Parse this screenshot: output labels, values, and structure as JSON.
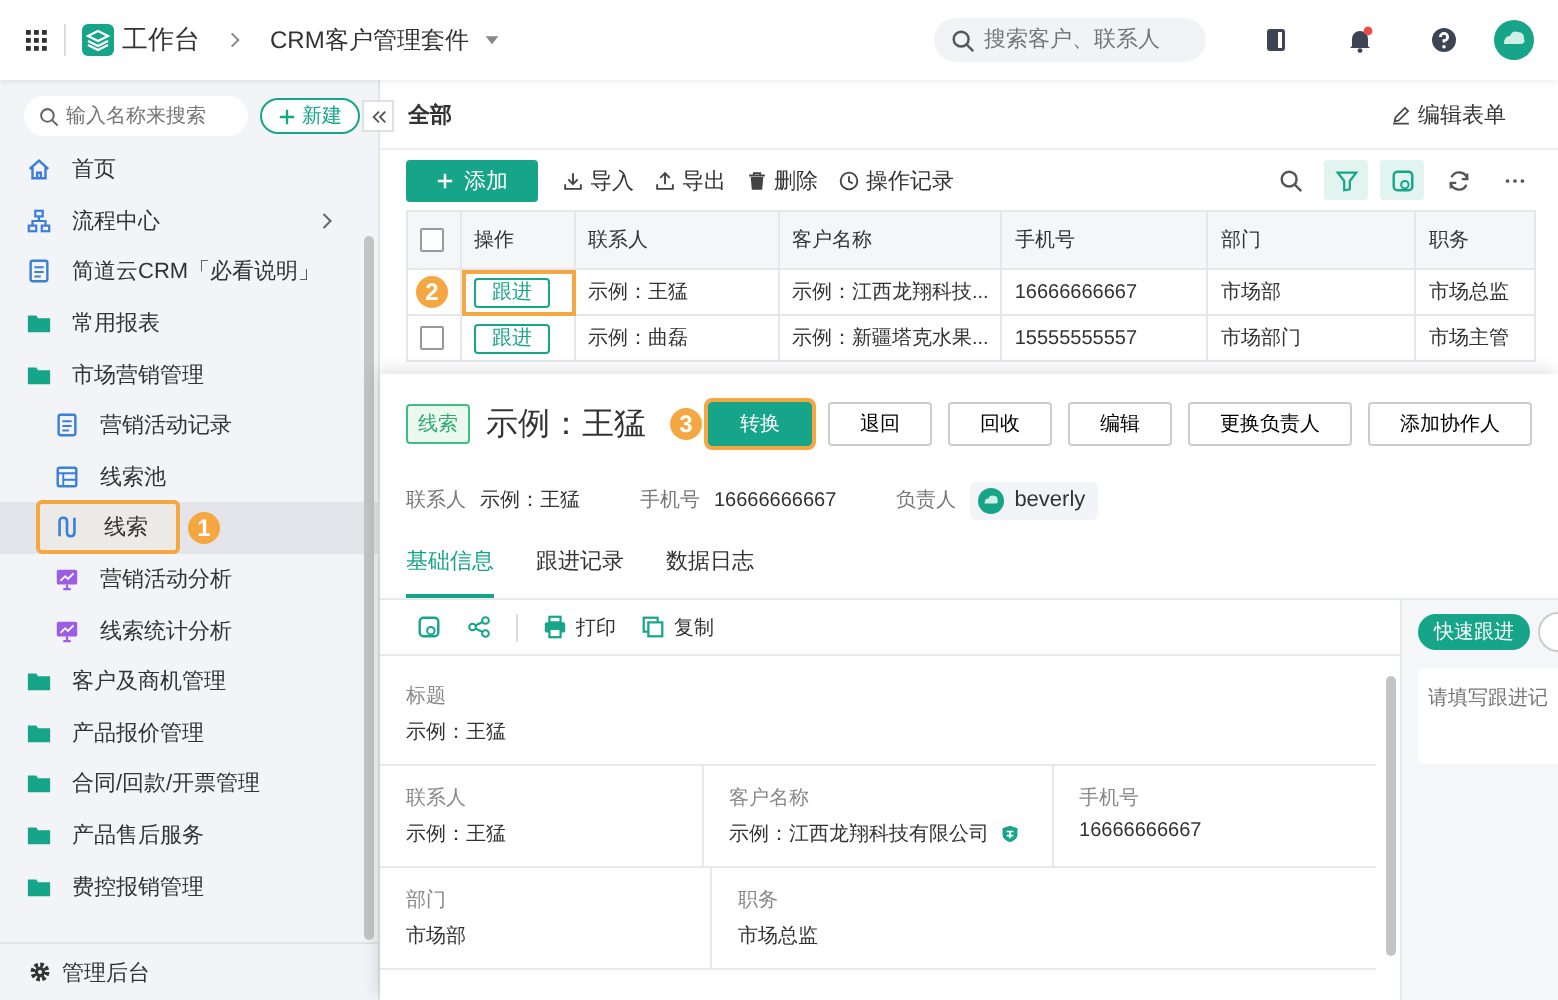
{
  "top_bar": {
    "app_name": "工作台",
    "breadcrumb": "CRM客户管理套件",
    "search": {
      "placeholder": "搜索客户、联系人"
    },
    "notifications_unread": true
  },
  "sidebar": {
    "search": {
      "placeholder": "输入名称来搜索"
    },
    "new_button": "新建",
    "items": [
      {
        "label": "首页",
        "kind": "home",
        "selected": false
      },
      {
        "label": "流程中心",
        "kind": "flow",
        "selected": false
      },
      {
        "label": "简道云CRM「必看说明」",
        "kind": "doc",
        "selected": false
      },
      {
        "label": "常用报表",
        "kind": "folder",
        "selected": false
      },
      {
        "label": "市场营销管理",
        "kind": "folder",
        "selected": false,
        "children": [
          {
            "label": "营销活动记录",
            "kind": "doc",
            "selected": false
          },
          {
            "label": "线索池",
            "kind": "pool",
            "selected": false
          },
          {
            "label": "线索",
            "kind": "lead",
            "selected": true,
            "callout": "1"
          },
          {
            "label": "营销活动分析",
            "kind": "chart",
            "selected": false
          },
          {
            "label": "线索统计分析",
            "kind": "chart",
            "selected": false
          }
        ]
      },
      {
        "label": "客户及商机管理",
        "kind": "folder",
        "selected": false
      },
      {
        "label": "产品报价管理",
        "kind": "folder",
        "selected": false
      },
      {
        "label": "合同/回款/开票管理",
        "kind": "folder",
        "selected": false
      },
      {
        "label": "产品售后服务",
        "kind": "folder",
        "selected": false
      },
      {
        "label": "费控报销管理",
        "kind": "folder",
        "selected": false
      }
    ],
    "footer": "管理后台"
  },
  "main": {
    "view_title": "全部",
    "edit_form": "编辑表单",
    "add_button": "添加",
    "actions": [
      {
        "label": "导入",
        "kind": "import"
      },
      {
        "label": "导出",
        "kind": "export"
      },
      {
        "label": "删除",
        "kind": "delete"
      },
      {
        "label": "操作记录",
        "kind": "history"
      }
    ],
    "tools": [
      {
        "kind": "search",
        "active": false
      },
      {
        "kind": "filter",
        "active": true
      },
      {
        "kind": "card",
        "active": true
      },
      {
        "kind": "refresh",
        "active": false
      },
      {
        "kind": "more",
        "active": false
      }
    ],
    "table": {
      "all_checked": false,
      "action_column": "操作",
      "columns": [
        "联系人",
        "客户名称",
        "手机号",
        "部门",
        "职务"
      ],
      "rows": [
        {
          "callout": "2",
          "action": "跟进",
          "cells": [
            "示例：王猛",
            "示例：江西龙翔科技...",
            "16666666667",
            "市场部",
            "市场总监"
          ]
        },
        {
          "checked": false,
          "action": "跟进",
          "cells": [
            "示例：曲磊",
            "示例：新疆塔克水果...",
            "15555555557",
            "市场部门",
            "市场主管"
          ]
        }
      ]
    }
  },
  "detail": {
    "tag": "线索",
    "title": "示例：王猛",
    "buttons": [
      {
        "label": "转换",
        "primary": true,
        "callout": "3"
      },
      {
        "label": "退回",
        "primary": false
      },
      {
        "label": "回收",
        "primary": false
      },
      {
        "label": "编辑",
        "primary": false
      },
      {
        "label": "更换负责人",
        "primary": false
      },
      {
        "label": "添加协作人",
        "primary": false
      }
    ],
    "info": [
      {
        "label": "联系人",
        "value": "示例：王猛"
      },
      {
        "label": "手机号",
        "value": "16666666667"
      }
    ],
    "owner": {
      "label": "负责人",
      "name": "beverly"
    },
    "tabs": [
      {
        "label": "基础信息",
        "selected": true
      },
      {
        "label": "跟进记录",
        "selected": false
      },
      {
        "label": "数据日志",
        "selected": false
      }
    ],
    "tools": [
      {
        "kind": "card"
      },
      {
        "kind": "share"
      },
      {
        "kind": "print",
        "label": "打印"
      },
      {
        "kind": "copy",
        "label": "复制"
      }
    ],
    "field_rows": [
      [
        {
          "label": "标题",
          "value": "示例：王猛",
          "verified": false
        }
      ],
      [
        {
          "label": "联系人",
          "value": "示例：王猛",
          "verified": false
        },
        {
          "label": "客户名称",
          "value": "示例：江西龙翔科技有限公司",
          "verified": true
        },
        {
          "label": "手机号",
          "value": "16666666667",
          "verified": false
        }
      ],
      [
        {
          "label": "部门",
          "value": "市场部",
          "verified": false
        },
        {
          "label": "职务",
          "value": "市场总监",
          "verified": false
        }
      ]
    ],
    "follow_up": {
      "button": "快速跟进",
      "placeholder": "请填写跟进记"
    }
  }
}
